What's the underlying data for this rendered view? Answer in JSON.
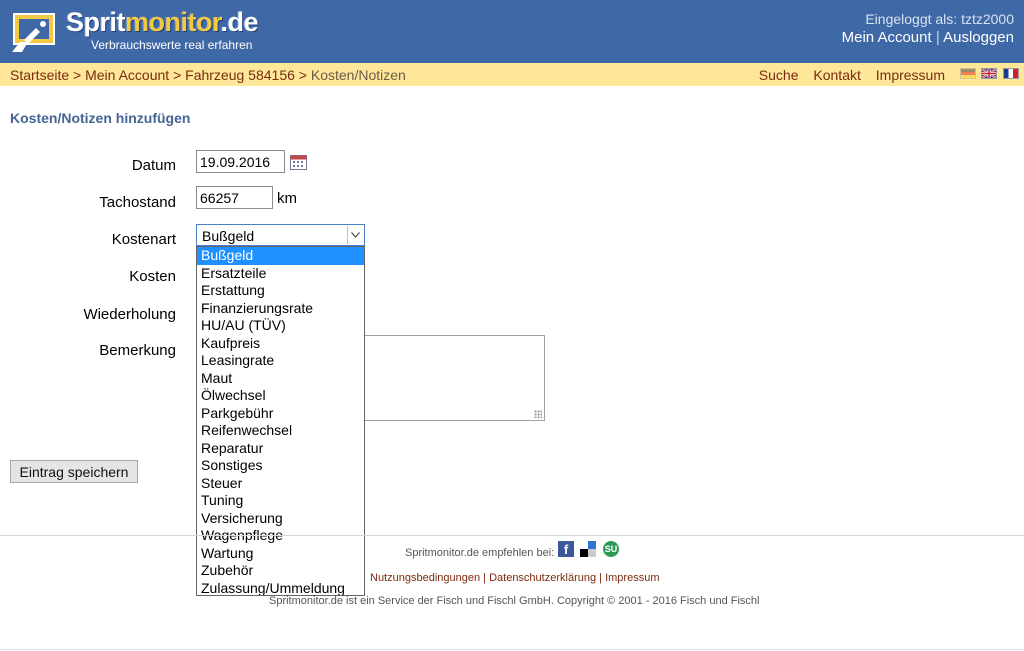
{
  "header": {
    "logo_title_part1": "Sprit",
    "logo_title_part2": "monitor",
    "logo_title_part3": ".de",
    "logo_subtitle": "Verbrauchswerte real erfahren",
    "login_status": "Eingeloggt als: tztz2000",
    "my_account": "Mein Account",
    "separator": "|",
    "logout": "Ausloggen",
    "colors": {
      "bar": "#3f68a6",
      "logo_accent": "#f3c845"
    }
  },
  "navbar": {
    "breadcrumb": [
      "Startseite",
      "Mein Account",
      "Fahrzeug 584156",
      "Kosten/Notizen"
    ],
    "crumb_sep": ">",
    "links": [
      "Suche",
      "Kontakt",
      "Impressum"
    ],
    "flags": [
      "flag-de-icon",
      "flag-en-icon",
      "flag-fr-icon"
    ],
    "color": "#ffe79a"
  },
  "form": {
    "heading": "Kosten/Notizen hinzufügen",
    "labels": {
      "date": "Datum",
      "odometer": "Tachostand",
      "cost_type": "Kostenart",
      "costs": "Kosten",
      "repeat": "Wiederholung",
      "note": "Bemerkung"
    },
    "date_value": "19.09.2016",
    "odometer_value": "66257",
    "odometer_unit": "km",
    "cost_type_selected": "Bußgeld",
    "cost_type_options": [
      "Bußgeld",
      "Ersatzteile",
      "Erstattung",
      "Finanzierungsrate",
      "HU/AU (TÜV)",
      "Kaufpreis",
      "Leasingrate",
      "Maut",
      "Ölwechsel",
      "Parkgebühr",
      "Reifenwechsel",
      "Reparatur",
      "Sonstiges",
      "Steuer",
      "Tuning",
      "Versicherung",
      "Wagenpflege",
      "Wartung",
      "Zubehör",
      "Zulassung/Ummeldung"
    ],
    "save_label": "Eintrag speichern"
  },
  "footer": {
    "recommend": "Spritmonitor.de empfehlen bei:",
    "social_icons": [
      "facebook-icon",
      "delicious-icon",
      "stumbleupon-icon"
    ],
    "fb_glyph": "f",
    "su_glyph": "SU",
    "links": [
      "Nutzungsbedingungen",
      "Datenschutzerklärung",
      "Impressum"
    ],
    "link_sep": "|",
    "copyright": "Spritmonitor.de ist ein Service der Fisch und Fischl GmbH. Copyright © 2001 - 2016 Fisch und Fischl"
  }
}
